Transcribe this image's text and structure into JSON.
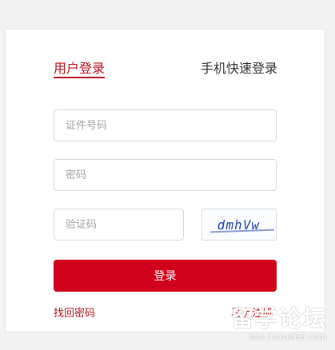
{
  "tabs": {
    "account_login": "用户登录",
    "phone_login": "手机快速登录"
  },
  "form": {
    "id_placeholder": "证件号码",
    "password_placeholder": "密码",
    "captcha_placeholder": "验证码",
    "captcha_image_text": "dmhVw"
  },
  "actions": {
    "login_label": "登录",
    "forgot_password": "找回密码",
    "register": "马上注册"
  },
  "watermark": {
    "title": "留学论坛",
    "url": "bbs.liuxue86.com"
  },
  "colors": {
    "accent": "#b5121b",
    "button": "#d0021b"
  }
}
